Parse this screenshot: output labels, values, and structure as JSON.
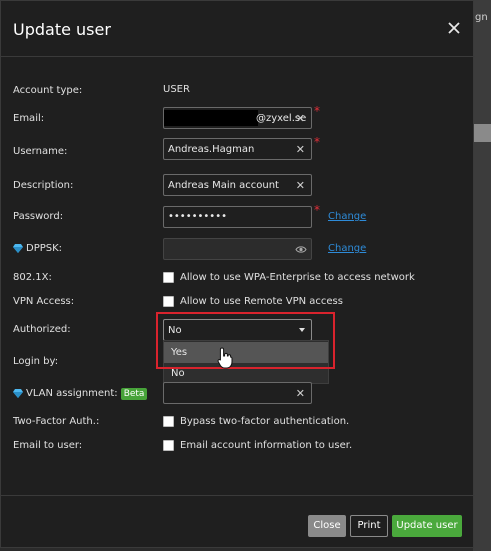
{
  "background": {
    "corner_text": "gn"
  },
  "dialog": {
    "title": "Update user",
    "close_icon": "close-icon"
  },
  "labels": {
    "account_type": "Account type:",
    "email": "Email:",
    "username": "Username:",
    "description": "Description:",
    "password": "Password:",
    "dppsk": "DPPSK:",
    "dot1x": "802.1X:",
    "vpn_access": "VPN Access:",
    "authorized": "Authorized:",
    "login_by": "Login by:",
    "vlan_assignment": "VLAN assignment:",
    "beta_badge": "Beta",
    "two_factor": "Two-Factor Auth.:",
    "email_to_user": "Email to user:"
  },
  "values": {
    "account_type": "USER",
    "email_visible_suffix": "@zyxel.se",
    "username": "Andreas.Hagman",
    "description": "Andreas Main account",
    "password_masked": "••••••••••",
    "dppsk": "",
    "vlan": ""
  },
  "required_mark": "*",
  "links": {
    "password_change": "Change",
    "dppsk_change": "Change"
  },
  "checkboxes": {
    "dot1x": {
      "label": "Allow to use WPA-Enterprise to access network",
      "checked": false
    },
    "vpn": {
      "label": "Allow to use Remote VPN access",
      "checked": false
    },
    "two_factor": {
      "label": "Bypass two-factor authentication.",
      "checked": false
    },
    "email_user": {
      "label": "Email account information to user.",
      "checked": false
    }
  },
  "authorized_select": {
    "selected": "No",
    "options": [
      "Yes",
      "No"
    ],
    "highlighted": "Yes"
  },
  "buttons": {
    "close": "Close",
    "print": "Print",
    "update": "Update user"
  },
  "colors": {
    "dialog_bg": "#1f1f1f",
    "required": "#e0303a",
    "link": "#2e8bd8",
    "primary_green": "#4aa93c",
    "highlight_box": "#d9232d",
    "gem_blue": "#4db8f0"
  },
  "icons": {
    "gem": "gem-icon",
    "eye": "eye-icon",
    "clear": "clear-x-icon",
    "cursor": "hand-cursor-icon"
  }
}
